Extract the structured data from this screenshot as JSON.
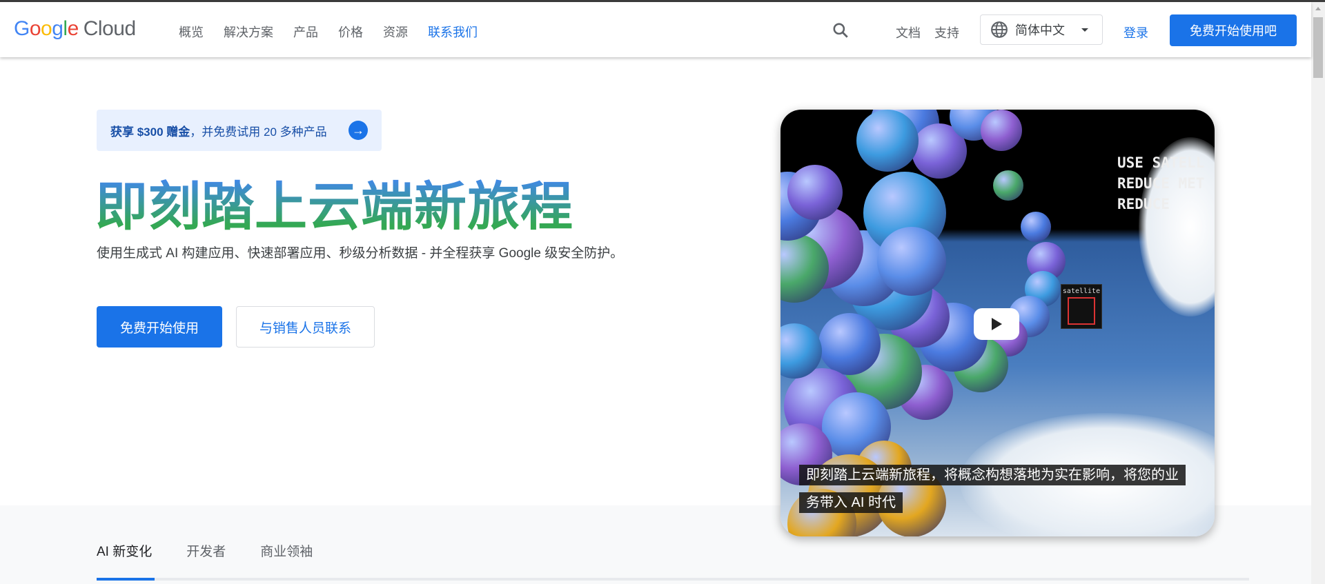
{
  "header": {
    "logo": {
      "google": "Google",
      "cloud": "Cloud"
    },
    "nav": [
      {
        "label": "概览",
        "active": false
      },
      {
        "label": "解决方案",
        "active": false
      },
      {
        "label": "产品",
        "active": false
      },
      {
        "label": "价格",
        "active": false
      },
      {
        "label": "资源",
        "active": false
      },
      {
        "label": "联系我们",
        "active": true
      }
    ],
    "search_icon": "search-icon",
    "docs": "文档",
    "support": "支持",
    "language": "简体中文",
    "login": "登录",
    "cta": "免费开始使用吧"
  },
  "hero": {
    "promo_bold": "获享 $300 赠金",
    "promo_rest": "，并免费试用 20 多种产品",
    "title": "即刻踏上云端新旅程",
    "subtitle": "使用生成式 AI 构建应用、快速部署应用、秒级分析数据 - 并全程获享 Google 级安全防护。",
    "primary_button": "免费开始使用",
    "secondary_button": "与销售人员联系"
  },
  "video": {
    "overlay_lines": [
      "USE SATELL",
      "REDUCE MET",
      "REDUCE"
    ],
    "satellite_label": "satellite",
    "caption": "即刻踏上云端新旅程，将概念构想落地为实在影响，将您的业务带入 AI 时代"
  },
  "tabs": [
    {
      "label": "AI 新变化",
      "active": true
    },
    {
      "label": "开发者",
      "active": false
    },
    {
      "label": "商业领袖",
      "active": false
    }
  ],
  "colors": {
    "accent": "#1a73e8",
    "title_gradient": [
      "#4285f4",
      "#34a853"
    ],
    "promo_bg": "#e8f0fe"
  }
}
